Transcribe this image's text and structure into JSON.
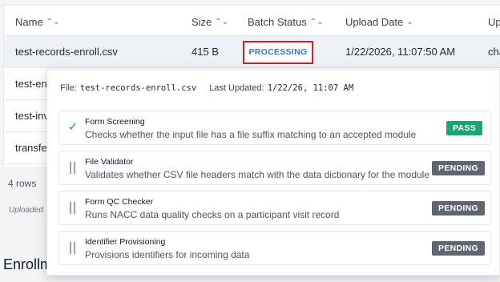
{
  "table": {
    "headers": {
      "name": "Name",
      "size": "Size",
      "batch_status": "Batch Status",
      "upload_date": "Upload Date",
      "uploaded_by": "Up"
    },
    "rows": [
      {
        "name": "test-records-enroll.csv",
        "size": "415 B",
        "status": "PROCESSING",
        "upload_date": "1/22/2026, 11:07:50 AM",
        "uploaded_by": "cha"
      },
      {
        "name": "test-enr"
      },
      {
        "name": "test-inv"
      },
      {
        "name": "transfer"
      }
    ],
    "row_count": "4 rows",
    "uploaded_note": "Uploaded"
  },
  "section_heading": "Enrollm",
  "popover": {
    "file_label": "File:",
    "file_name": "test-records-enroll.csv",
    "updated_label": "Last Updated:",
    "updated_value": "1/22/26, 11:07 AM",
    "steps": [
      {
        "title": "Form Screening",
        "description": "Checks whether the input file has a file suffix matching to an accepted module",
        "status": "PASS",
        "icon": "check-icon"
      },
      {
        "title": "File Validator",
        "description": "Validates whether CSV file headers match with the data dictionary for the module",
        "status": "PENDING",
        "icon": "pause-icon"
      },
      {
        "title": "Form QC Checker",
        "description": "Runs NACC data quality checks on a participant visit record",
        "status": "PENDING",
        "icon": "pause-icon"
      },
      {
        "title": "Identifier Provisioning",
        "description": "Provisions identifiers for incoming data",
        "status": "PENDING",
        "icon": "pause-icon"
      }
    ]
  },
  "colors": {
    "highlight": "#d0201f",
    "processing": "#3b73c9",
    "pass": "#17a673",
    "pending": "#5f6670"
  }
}
